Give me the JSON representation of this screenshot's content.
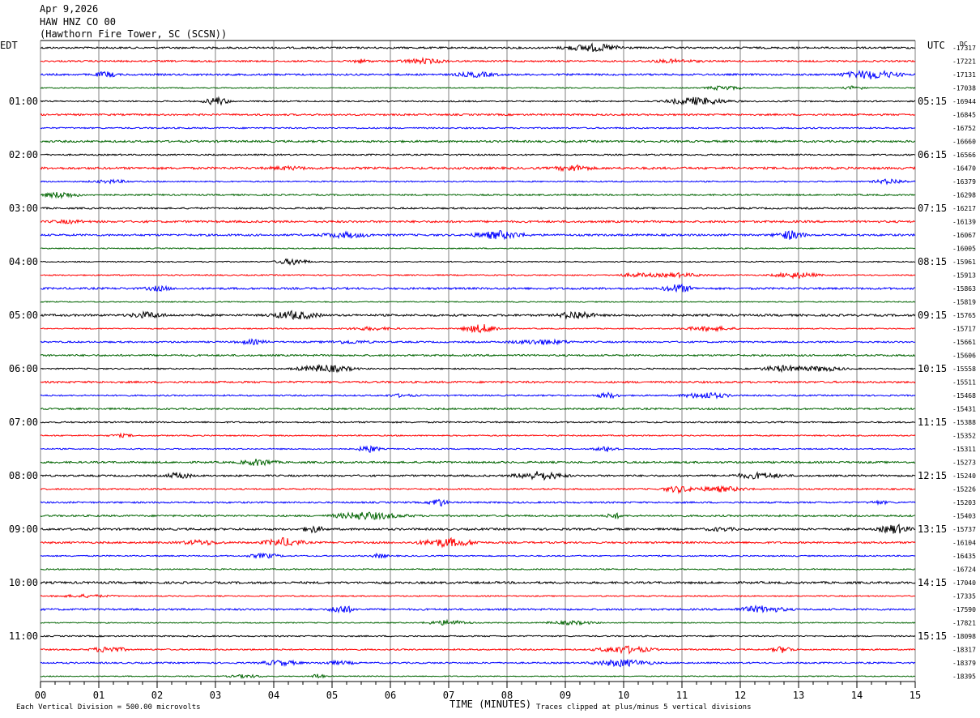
{
  "header": {
    "date": "Apr 9,2026",
    "channel": "HAW HNZ CO 00",
    "station": "(Hawthorn Fire Tower, SC (SCSN))"
  },
  "left_tz": "EDT",
  "right_tz": "UTC",
  "right_unit": "DC",
  "footer": {
    "left_note": "Each Vertical Division =  500.00 microvolts",
    "center_label": "TIME (MINUTES)",
    "right_note": "Traces clipped at plus/minus 5 vertical divisions"
  },
  "colors": {
    "cycle": [
      "#000000",
      "#ff0000",
      "#0000ff",
      "#006400"
    ],
    "grid": "#808080"
  },
  "chart_data": {
    "type": "line",
    "title": "",
    "xlabel": "TIME (MINUTES)",
    "ylabel": "",
    "xlim": [
      0,
      15
    ],
    "x_ticks": [
      "00",
      "01",
      "02",
      "03",
      "04",
      "05",
      "06",
      "07",
      "08",
      "09",
      "10",
      "11",
      "12",
      "13",
      "14",
      "15"
    ],
    "trace_count": 48,
    "left_hour_labels": [
      "01:00",
      "02:00",
      "03:00",
      "04:00",
      "05:00",
      "06:00",
      "07:00",
      "08:00",
      "09:00",
      "10:00",
      "11:00"
    ],
    "right_hour_labels": [
      "05:15",
      "06:15",
      "07:15",
      "08:15",
      "09:15",
      "10:15",
      "11:15",
      "12:15",
      "13:15",
      "14:15",
      "15:15"
    ],
    "dc_offsets": [
      "-17317",
      "-17221",
      "-17131",
      "-17038",
      "-16944",
      "-16845",
      "-16752",
      "-16660",
      "-16566",
      "-16470",
      "-16379",
      "-16298",
      "-16217",
      "-16139",
      "-16067",
      "-16005",
      "-15961",
      "-15913",
      "-15863",
      "-15819",
      "-15765",
      "-15717",
      "-15661",
      "-15606",
      "-15558",
      "-15511",
      "-15468",
      "-15431",
      "-15388",
      "-15352",
      "-15311",
      "-15273",
      "-15240",
      "-15226",
      "-15203",
      "-15403",
      "-15737",
      "-16104",
      "-16435",
      "-16724",
      "-17040",
      "-17335",
      "-17590",
      "-17821",
      "-18098",
      "-18317",
      "-18379",
      "-18395"
    ]
  }
}
